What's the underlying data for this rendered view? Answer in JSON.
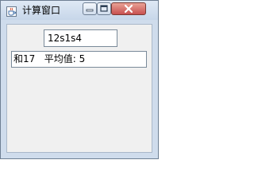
{
  "window": {
    "title": "计算窗口",
    "icon": "java-cup-icon",
    "controls": [
      "minimize-icon",
      "maximize-icon",
      "close-icon"
    ]
  },
  "input": {
    "value": "12s1s4"
  },
  "result": {
    "text": "和17   平均值: 5"
  },
  "colors": {
    "close_button": "#c75050",
    "titlebar": "#cfdcec",
    "client_bg": "#f0f0f0"
  }
}
